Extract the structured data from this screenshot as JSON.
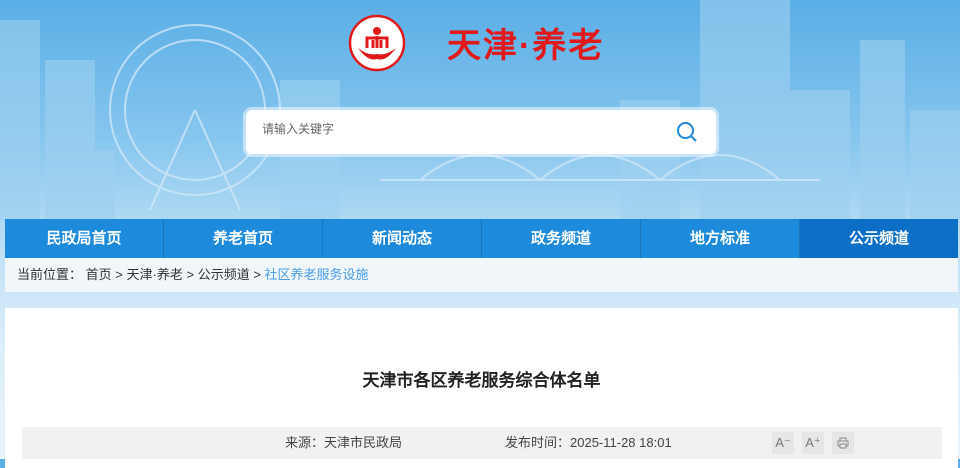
{
  "header": {
    "site_title": "天津·养老"
  },
  "search": {
    "placeholder": "请输入关键字"
  },
  "nav": {
    "items": [
      {
        "label": "民政局首页"
      },
      {
        "label": "养老首页"
      },
      {
        "label": "新闻动态"
      },
      {
        "label": "政务频道"
      },
      {
        "label": "地方标准"
      },
      {
        "label": "公示频道"
      }
    ]
  },
  "breadcrumb": {
    "prefix": "当前位置：",
    "items": [
      "首页",
      "天津·养老",
      "公示频道",
      "社区养老服务设施"
    ],
    "sep": ">"
  },
  "article": {
    "title": "天津市各区养老服务综合体名单",
    "source": "来源：天津市民政局",
    "published": "发布时间：2025-11-28 18:01",
    "font_decrease": "A⁻",
    "font_increase": "A⁺"
  },
  "colors": {
    "brand_red": "#e01a1a",
    "nav_blue": "#1e8adb",
    "nav_active": "#0c6ec4",
    "crumb_current": "#4a9ee8"
  }
}
